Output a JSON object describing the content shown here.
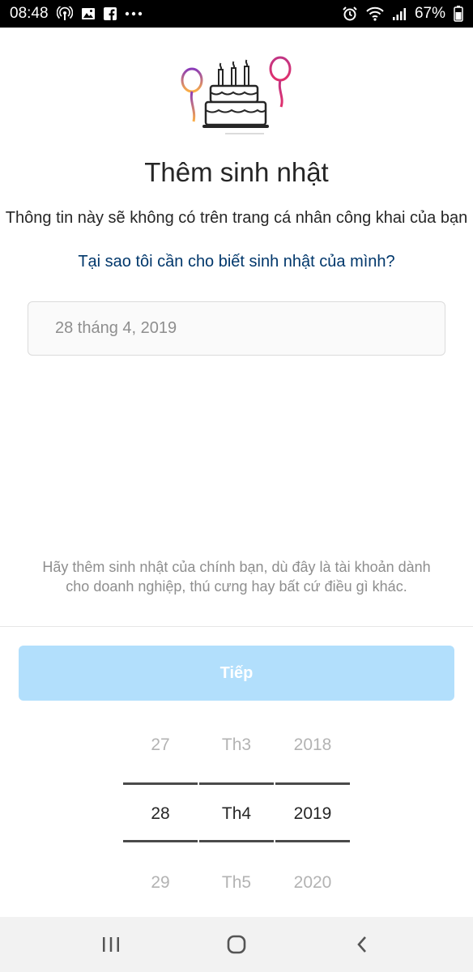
{
  "status_bar": {
    "time": "08:48",
    "battery": "67%",
    "left_icons": [
      "podcast-icon",
      "image-icon",
      "facebook-icon",
      "more-dots-icon"
    ],
    "right_icons": [
      "alarm-icon",
      "wifi-icon",
      "signal-icon",
      "battery-icon"
    ]
  },
  "header": {
    "title": "Thêm sinh nhật",
    "subtitle": "Thông tin này sẽ không có trên trang cá nhân công khai của bạn",
    "why_link": "Tại sao tôi cần cho biết sinh nhật của mình?"
  },
  "form": {
    "date_value": "28 tháng 4, 2019",
    "hint": "Hãy thêm sinh nhật của chính bạn, dù đây là tài khoản dành cho doanh nghiệp, thú cưng hay bất cứ điều gì khác.",
    "next_label": "Tiếp"
  },
  "picker": {
    "day": {
      "prev": "27",
      "selected": "28",
      "next": "29"
    },
    "month": {
      "prev": "Th3",
      "selected": "Th4",
      "next": "Th5"
    },
    "year": {
      "prev": "2018",
      "selected": "2019",
      "next": "2020"
    }
  },
  "colors": {
    "link": "#00376b",
    "button_disabled": "#b2dffc",
    "balloon_left": "#8a3ab9",
    "balloon_right": "#c13584"
  },
  "nav_bar": {
    "icons": [
      "recent-apps-icon",
      "home-icon",
      "back-icon"
    ]
  }
}
